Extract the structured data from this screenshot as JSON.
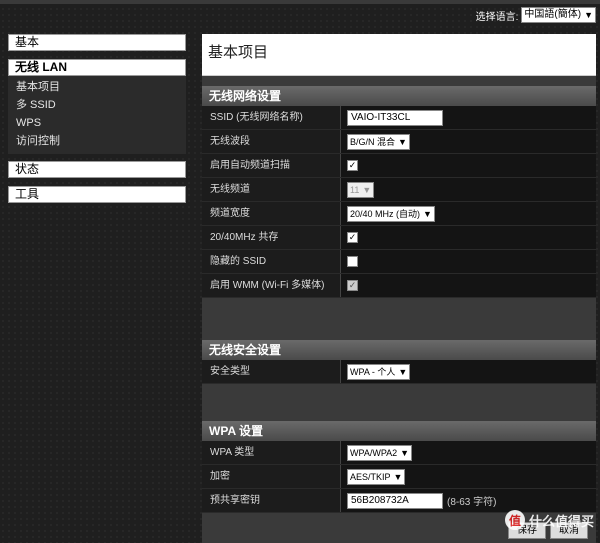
{
  "language": {
    "label": "选择语言:",
    "selected": "中国語(簡体)"
  },
  "sidebar": {
    "basic": "基本",
    "wireless_lan": "无线 LAN",
    "sub_items": [
      "基本项目",
      "多 SSID",
      "WPS",
      "访问控制"
    ],
    "status": "状态",
    "tools": "工具"
  },
  "page_title": "基本项目",
  "wireless": {
    "header": "无线网络设置",
    "ssid_label": "SSID (无线网络名称)",
    "ssid_value": "VAIO-IT33CL",
    "band_label": "无线波段",
    "band_value": "B/G/N 混合",
    "autoscan_label": "启用自动频道扫描",
    "channel_label": "无线频道",
    "channel_value": "11",
    "bandwidth_label": "频道宽度",
    "bandwidth_value": "20/40 MHz (自动)",
    "coexist_label": "20/40MHz 共存",
    "hidden_label": "隐藏的 SSID",
    "wmm_label": "启用 WMM (Wi-Fi 多媒体)"
  },
  "security": {
    "header": "无线安全设置",
    "type_label": "安全类型",
    "type_value": "WPA - 个人"
  },
  "wpa": {
    "header": "WPA 设置",
    "type_label": "WPA 类型",
    "type_value": "WPA/WPA2",
    "encrypt_label": "加密",
    "encrypt_value": "AES/TKIP",
    "psk_label": "预共享密钥",
    "psk_value": "56B208732A",
    "psk_hint": "(8-63 字符)"
  },
  "buttons": {
    "save": "保存",
    "cancel": "取消"
  },
  "watermark": {
    "logo": "值",
    "text": "什么值得买"
  }
}
